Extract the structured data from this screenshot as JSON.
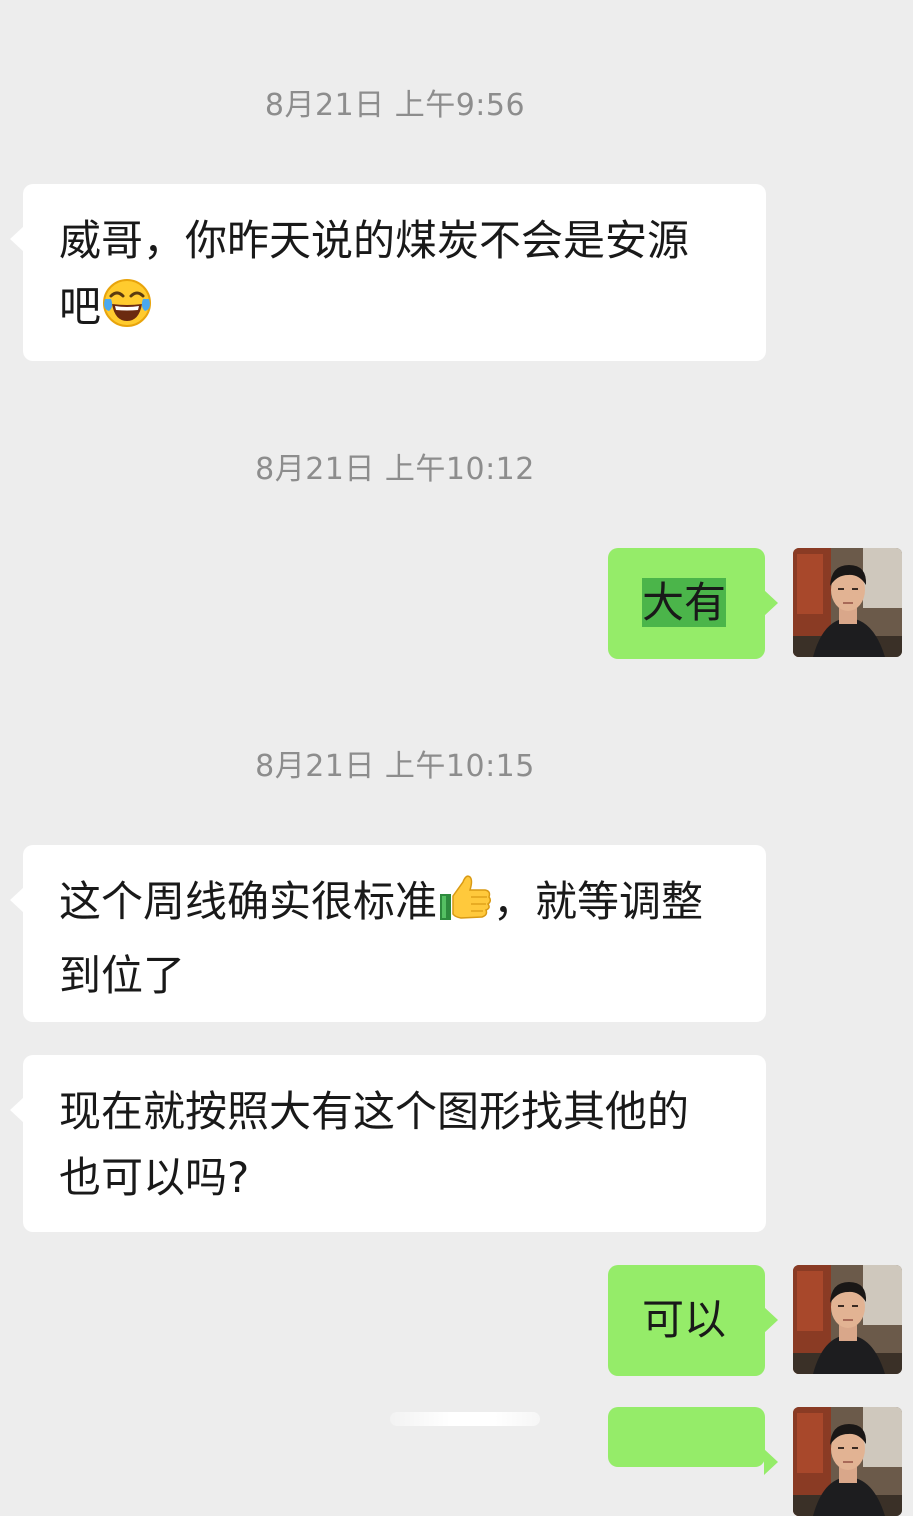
{
  "messages": {
    "ts1": "8月21日 上午9:56",
    "m1_line1": "威哥，你昨天说的煤炭不会是安源",
    "m1_line2": "吧",
    "ts2": "8月21日 上午10:12",
    "m2": "大有",
    "ts3": "8月21日 上午10:15",
    "m3_line1_a": "这个周线确实很标准",
    "m3_line1_b": "，就等调整",
    "m3_line2": "到位了",
    "m4_line1": "现在就按照大有这个图形找其他的",
    "m4_line2": "也可以吗?",
    "m5": "可以"
  },
  "icons": {
    "laughing_emoji": "face-with-tears-of-joy-icon",
    "thumbs_up_emoji": "thumbs-up-icon"
  },
  "colors": {
    "background": "#ededed",
    "incoming_bubble": "#ffffff",
    "outgoing_bubble": "#95ec69",
    "timestamp": "#8d8d8d",
    "highlight": "#4bb54a"
  }
}
